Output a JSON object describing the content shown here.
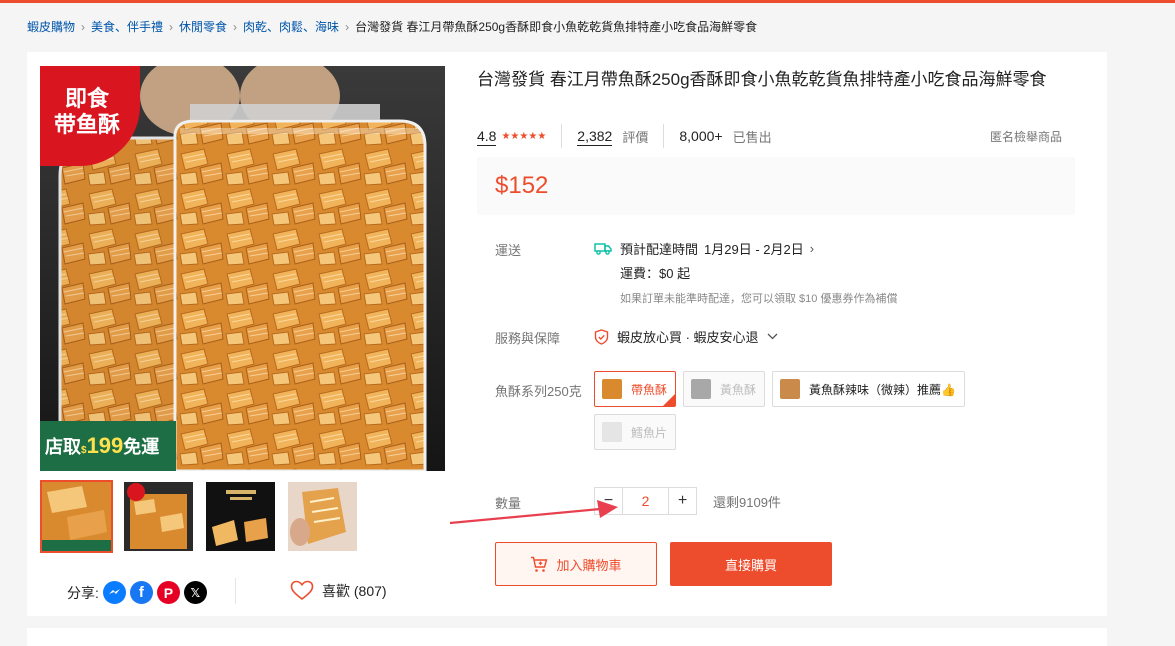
{
  "breadcrumb": [
    {
      "label": "蝦皮購物"
    },
    {
      "label": "美食、伴手禮"
    },
    {
      "label": "休閒零食"
    },
    {
      "label": "肉乾、肉鬆、海味"
    }
  ],
  "breadcrumb_current": "台灣發貨 春江月帶魚酥250g香酥即食小魚乾乾貨魚排特產小吃食品海鮮零食",
  "product": {
    "title": "台灣發貨 春江月帶魚酥250g香酥即食小魚乾乾貨魚排特產小吃食品海鮮零食",
    "rating": "4.8",
    "stars": "★★★★★",
    "review_count": "2,382",
    "review_label": "評價",
    "sold_count": "8,000+",
    "sold_label": "已售出",
    "report_label": "匿名檢舉商品",
    "price": "$152"
  },
  "image_badges": {
    "top_badge_line1": "即食",
    "top_badge_line2": "带鱼酥",
    "bottom_badge_prefix": "店取",
    "bottom_badge_currency": "$",
    "bottom_badge_amount": "199",
    "bottom_badge_suffix": "免運"
  },
  "shipping": {
    "label": "運送",
    "eta_prefix": "預計配達時間",
    "eta_range": "1月29日 - 2月2日",
    "fee": "運費：$0 起",
    "note": "如果訂單未能準時配達，您可以領取 $10 優惠券作為補償"
  },
  "guarantee": {
    "label": "服務與保障",
    "text": "蝦皮放心買 · 蝦皮安心退"
  },
  "variants": {
    "label": "魚酥系列250克",
    "options": [
      {
        "label": "帶魚酥",
        "state": "selected"
      },
      {
        "label": "黃魚酥",
        "state": "disabled"
      },
      {
        "label": "黃魚酥辣味（微辣）推薦👍",
        "state": "normal"
      },
      {
        "label": "鱈魚片",
        "state": "disabled"
      }
    ]
  },
  "quantity": {
    "label": "數量",
    "minus": "−",
    "value": "2",
    "plus": "+",
    "stock": "還剩9109件"
  },
  "actions": {
    "add_to_cart": "加入購物車",
    "buy_now": "直接購買"
  },
  "share": {
    "label": "分享:",
    "icons": [
      "messenger-icon",
      "facebook-icon",
      "pinterest-icon",
      "x-icon"
    ]
  },
  "like": {
    "label": "喜歡 (807)"
  },
  "colors": {
    "brand": "#ee4d2d",
    "link": "#0055aa",
    "arrow": "#e8404f"
  }
}
